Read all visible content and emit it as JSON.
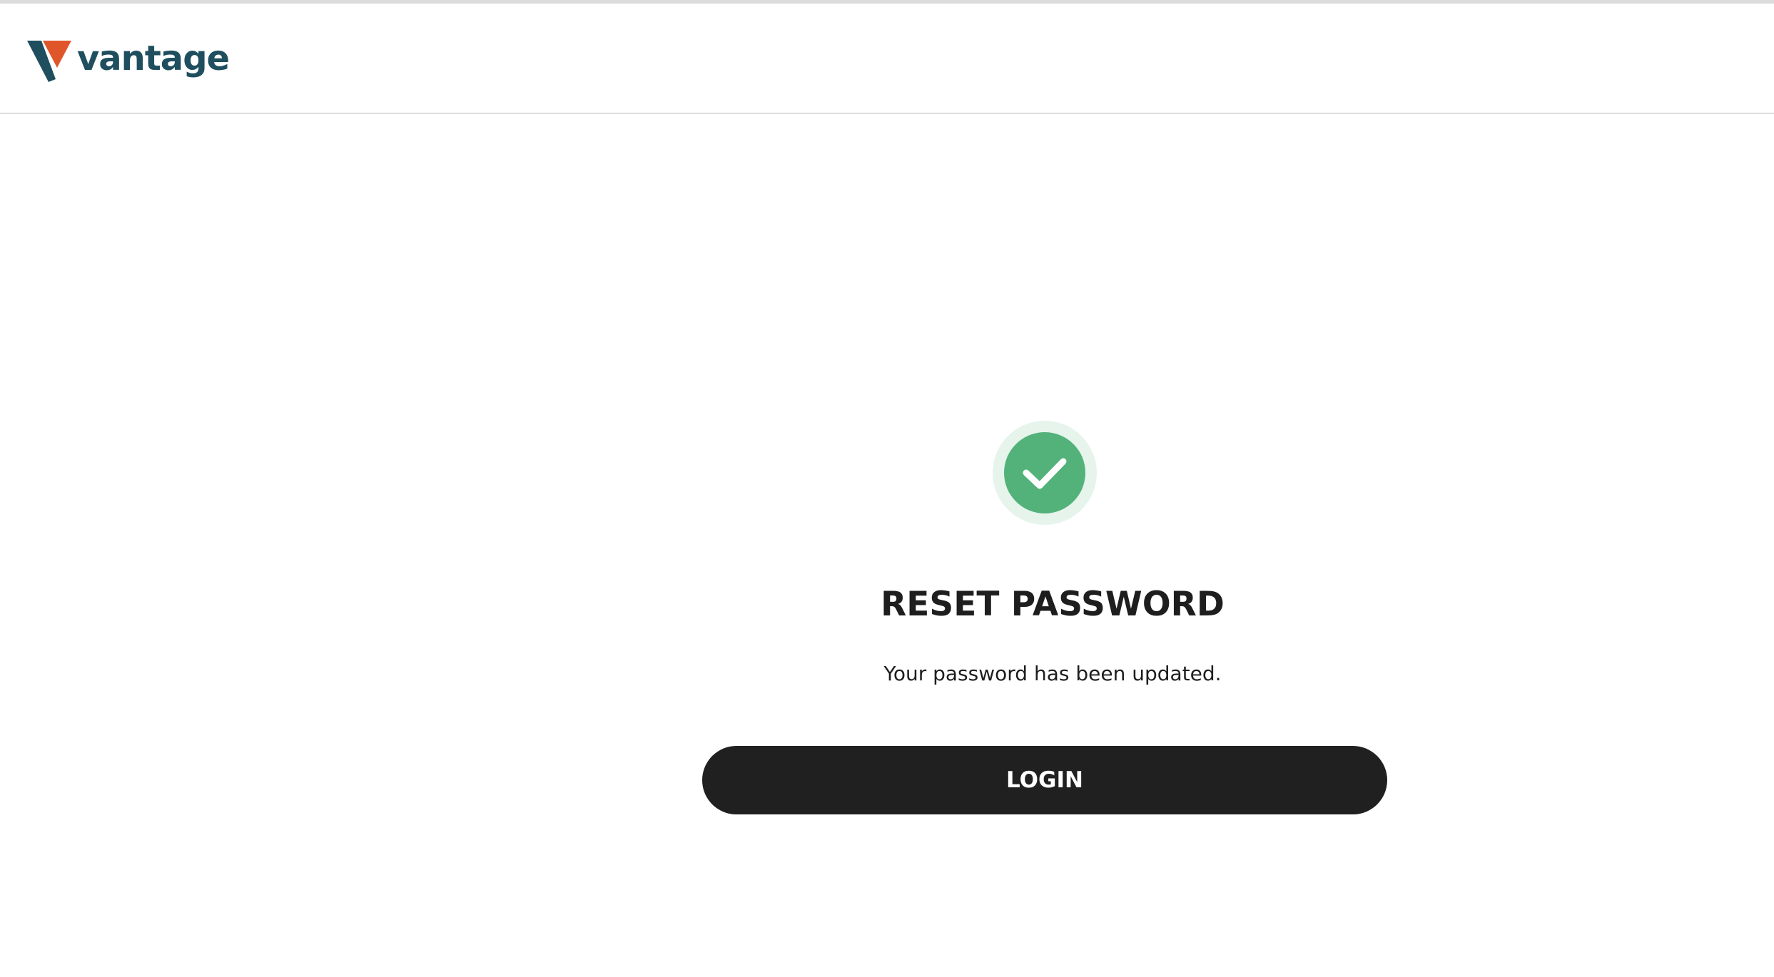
{
  "header": {
    "brand_name": "vantage",
    "logo_colors": {
      "mark_dark": "#1f4f5e",
      "mark_accent": "#e0562b"
    }
  },
  "reset": {
    "icon": "checkmark-circle-icon",
    "icon_color": "#52b27a",
    "icon_halo_color": "#e6f4ec",
    "title": "RESET PASSWORD",
    "message": "Your password has been updated.",
    "button_label": "LOGIN",
    "button_color": "#202020"
  }
}
